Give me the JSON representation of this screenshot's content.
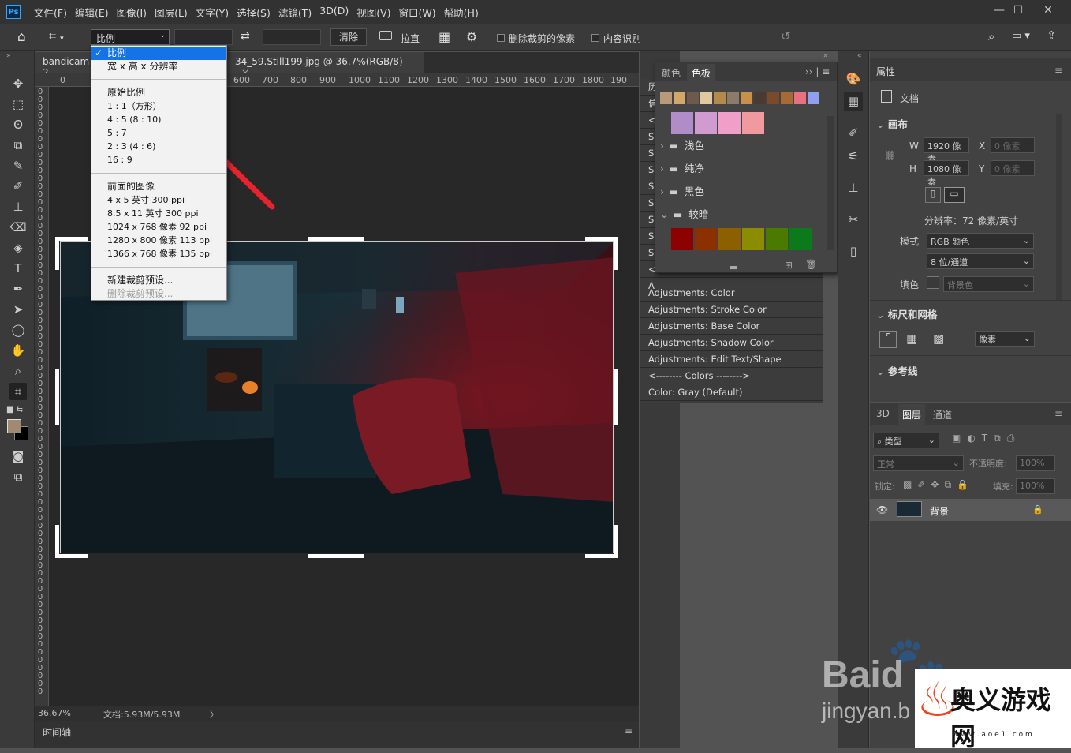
{
  "app": {
    "logo": "Ps"
  },
  "menu": [
    "文件(F)",
    "编辑(E)",
    "图像(I)",
    "图层(L)",
    "文字(Y)",
    "选择(S)",
    "滤镜(T)",
    "3D(D)",
    "视图(V)",
    "窗口(W)",
    "帮助(H)"
  ],
  "window_controls": {
    "minimize": "—",
    "maximize": "☐",
    "close": "✕"
  },
  "options": {
    "ratio_select": "比例",
    "swap": "⇄",
    "clear": "清除",
    "straighten": "拉直",
    "delete_cropped": "删除裁剪的像素",
    "content_aware": "内容识别"
  },
  "tabs": {
    "tab1": "bandicam 2",
    "tab2": "34_59.Still199.jpg @ 36.7%(RGB/8)",
    "tab2_close": "×"
  },
  "ruler_h": [
    "0",
    "600",
    "700",
    "800",
    "900",
    "1000",
    "1100",
    "1200",
    "1300",
    "1400",
    "1500",
    "1600",
    "1700",
    "1800",
    "190"
  ],
  "ruler_v": [
    "0",
    "0",
    "0",
    "0",
    "0",
    "0",
    "0",
    "0",
    "0",
    "0",
    "0",
    "0",
    "0",
    "0",
    "0",
    "0",
    "0",
    "0",
    "0",
    "0",
    "0",
    "0",
    "0",
    "0",
    "0",
    "0",
    "0",
    "0",
    "0",
    "0",
    "0",
    "0",
    "0",
    "0",
    "0",
    "0",
    "0",
    "0",
    "0",
    "0",
    "0",
    "0",
    "0",
    "0",
    "0",
    "0",
    "0",
    "0",
    "0",
    "0",
    "0",
    "0",
    "0",
    "0",
    "0",
    "0",
    "0",
    "0",
    "0",
    "0",
    "0",
    "0",
    "0",
    "0",
    "0",
    "0",
    "0",
    "0",
    "0",
    "0",
    "0",
    "0",
    "0",
    "0",
    "0",
    "0",
    "0"
  ],
  "dropdown": {
    "selected_check": "✓",
    "items_group1": [
      "比例",
      "宽 x 高 x 分辨率"
    ],
    "items_group2": [
      "原始比例",
      "1 : 1（方形）",
      "4 : 5 (8 : 10)",
      "5 : 7",
      "2 : 3 (4 : 6)",
      "16 : 9"
    ],
    "items_group3": [
      "前面的图像",
      "4 x 5 英寸 300 ppi",
      "8.5 x 11 英寸 300 ppi",
      "1024 x 768 像素 92 ppi",
      "1280 x 800 像素 113 ppi",
      "1366 x 768 像素 135 ppi"
    ],
    "items_group4": [
      "新建裁剪预设...",
      "删除裁剪预设..."
    ]
  },
  "status": {
    "zoom": "36.67%",
    "doc": "文档:5.93M/5.93M",
    "arrow": "〉"
  },
  "timeline": {
    "label": "时间轴"
  },
  "swatches_panel": {
    "tab_color": "颜色",
    "tab_swatches": "色板",
    "top_colors": [
      "#b89a7a",
      "#d4a66a",
      "#6e5a4a",
      "#e0c8a0",
      "#b48a4a",
      "#8c7a6a",
      "#c89048",
      "#4a3a34",
      "#7a4a2a",
      "#a86a34",
      "#e87080",
      "#90a0f0"
    ],
    "purple_colors": [
      "#b08cc8",
      "#d09cd0",
      "#f0a0c8",
      "#f09aa0"
    ],
    "groups": [
      "浅色",
      "纯净",
      "黑色",
      "较暗"
    ],
    "dark_colors": [
      "#8c0000",
      "#8c3000",
      "#8c6000",
      "#8c8c00",
      "#4a7a00",
      "#0a7a1a"
    ]
  },
  "history": {
    "left_labels": [
      "历",
      "信",
      "<",
      "S",
      "S",
      "S",
      "S",
      "S",
      "S",
      "S",
      "S",
      "<",
      "A"
    ],
    "rows": [
      "Adjustments: Color",
      "Adjustments: Stroke Color",
      "Adjustments: Base Color",
      "Adjustments: Shadow Color",
      "Adjustments: Edit Text/Shape",
      "<-------- Colors -------->",
      "Color: Gray (Default)"
    ]
  },
  "properties": {
    "title": "属性",
    "doc_label": "文档",
    "canvas_section": "画布",
    "w_label": "W",
    "w_value": "1920 像素",
    "h_label": "H",
    "h_value": "1080 像素",
    "x_label": "X",
    "x_placeholder": "0 像素",
    "y_label": "Y",
    "y_placeholder": "0 像素",
    "resolution": "分辨率：72 像素/英寸",
    "mode_label": "模式",
    "mode_value": "RGB 颜色",
    "depth_value": "8 位/通道",
    "fill_label": "填色",
    "fill_value": "背景色",
    "rulers_section": "标尺和网格",
    "units_value": "像素",
    "guides_section": "参考线"
  },
  "layers": {
    "tab_3d": "3D",
    "tab_layers": "图层",
    "tab_channels": "通道",
    "filter_label": "类型",
    "blend_mode": "正常",
    "opacity_label": "不透明度:",
    "opacity_value": "100%",
    "lock_label": "锁定:",
    "fill_label": "填充:",
    "fill_value": "100%",
    "layer_name": "背景"
  },
  "watermark": {
    "baidu": "Baid",
    "jingyan": "jingyan.b",
    "site": "奥义游戏网",
    "url": "w w w . a o e 1 . c o m"
  }
}
